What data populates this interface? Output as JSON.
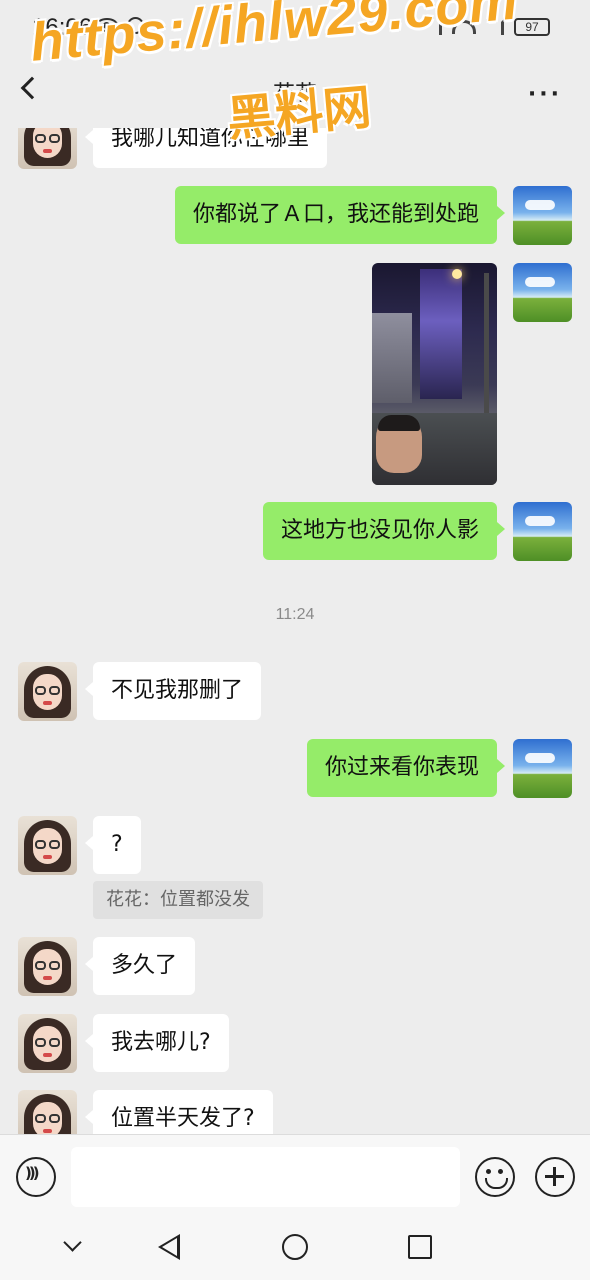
{
  "status_bar": {
    "time": "16:06",
    "battery": "97",
    "icons": [
      "eye-icon",
      "alarm-icon",
      "vibrate-icon",
      "wifi-icon",
      "signal-icon",
      "battery-icon"
    ]
  },
  "header": {
    "title": "花花",
    "more_label": "···"
  },
  "watermark": {
    "line1": "https://ihlw29.com",
    "line2": "黑料网",
    "color": "#f5a623"
  },
  "messages": [
    {
      "side": "in",
      "text": "我哪儿知道你在哪里"
    },
    {
      "side": "out",
      "text": "你都说了Ａ口，我还能到处跑"
    },
    {
      "side": "out",
      "type": "image",
      "description_icon": "photo-thumbnail"
    },
    {
      "side": "out",
      "text": "这地方也没见你人影"
    },
    {
      "type": "time",
      "text": "11:24"
    },
    {
      "side": "in",
      "text": "不见我那删了"
    },
    {
      "side": "out",
      "text": "你过来看你表现"
    },
    {
      "side": "in",
      "text": "?"
    },
    {
      "type": "system",
      "text": "花花：位置都没发"
    },
    {
      "side": "in",
      "text": "多久了"
    },
    {
      "side": "in",
      "text": "我去哪儿?"
    },
    {
      "side": "in",
      "text": "位置半天发了?"
    }
  ],
  "input_bar": {
    "placeholder": "",
    "icons": [
      "voice-icon",
      "emoji-icon",
      "plus-icon"
    ]
  },
  "nav_bar": {
    "icons": [
      "chevron-down-icon",
      "back-triangle-icon",
      "home-circle-icon",
      "recents-square-icon"
    ]
  },
  "colors": {
    "background": "#ededed",
    "outgoing_bubble": "#95ec69",
    "incoming_bubble": "#ffffff"
  }
}
